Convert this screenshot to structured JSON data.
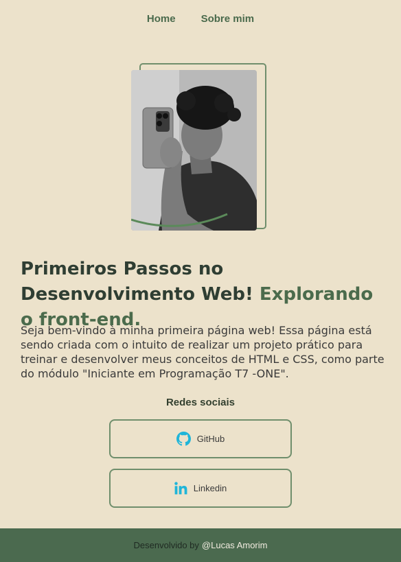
{
  "nav": {
    "items": [
      {
        "label": "Home"
      },
      {
        "label": "Sobre mim"
      }
    ]
  },
  "hero": {
    "title_main": "Primeiros Passos no Desenvolvimento Web!",
    "title_accent": "Explorando o front-end.",
    "description": "Seja bem-vindo à minha primeira página web! Essa página está sendo criada com o intuito de realizar um projeto prático para treinar e desenvolver meus conceitos de HTML e CSS, como parte do módulo \"Iniciante em Programação T7 -ONE\"."
  },
  "social": {
    "title": "Redes sociais",
    "links": [
      {
        "label": "GitHub",
        "icon": "github-icon"
      },
      {
        "label": "Linkedin",
        "icon": "linkedin-icon"
      }
    ]
  },
  "footer": {
    "prefix": "Desenvolvido by",
    "author": "@Lucas Amorim"
  },
  "colors": {
    "background": "#ece2cb",
    "accent": "#4b6b4c",
    "border": "#6f8e6c",
    "footer_bg": "#4b6a4f",
    "icon": "#1fb5d9"
  }
}
